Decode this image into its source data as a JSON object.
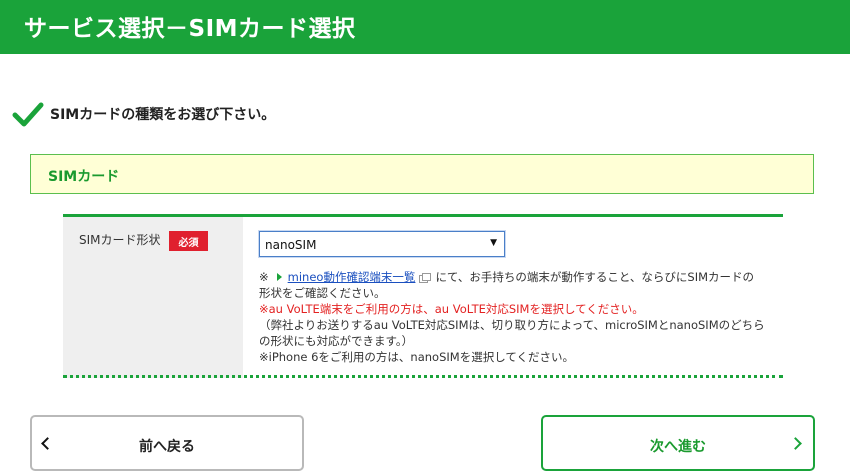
{
  "header": {
    "title": "サービス選択－SIMカード選択"
  },
  "prompt": {
    "text": "SIMカードの種類をお選び下さい。"
  },
  "section": {
    "title": "SIMカード"
  },
  "form": {
    "field_label": "SIMカード形状",
    "required_badge": "必須",
    "select_value": "nanoSIM",
    "notes": {
      "prefix": "※",
      "link_text": "mineo動作確認端末一覧",
      "line1_after_link": "にて、お手持ちの端末が動作すること、ならびにSIMカードの",
      "line1_cont": "形状をご確認ください。",
      "line2": "※au VoLTE端末をご利用の方は、au VoLTE対応SIMを選択してください。",
      "line3": "（弊社よりお送りするau VoLTE対応SIMは、切り取り方によって、microSIMとnanoSIMのどちら",
      "line3_cont": "の形状にも対応ができます。）",
      "line4": "※iPhone 6をご利用の方は、nanoSIMを選択してください。"
    }
  },
  "buttons": {
    "back_label": "前へ戻る",
    "next_label": "次へ進む"
  },
  "colors": {
    "brand_green": "#1aa33a",
    "required_red": "#e0202e",
    "section_bg": "#ffffd6"
  }
}
